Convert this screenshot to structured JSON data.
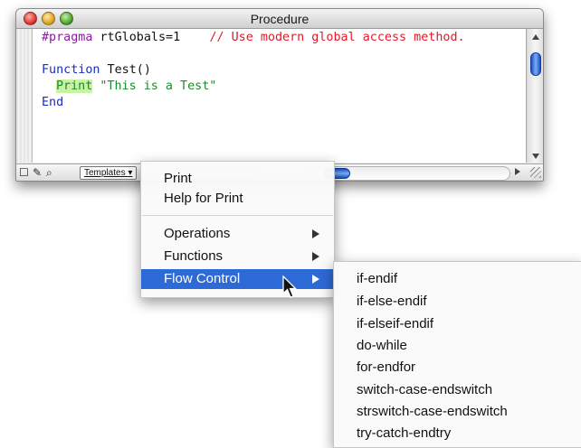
{
  "window": {
    "title": "Procedure"
  },
  "editor": {
    "line1": {
      "pragma": "#pragma",
      "text": " rtGlobals=1",
      "comment": "// Use modern global access method."
    },
    "line2": {
      "keyword": "Function",
      "text": " Test()"
    },
    "line3": {
      "keyword": "Print",
      "string": "\"This is a Test\""
    },
    "line4": {
      "keyword": "End"
    }
  },
  "toolbar": {
    "templates_label": "Templates"
  },
  "context_menu": {
    "items": [
      "Print",
      "Help for Print",
      "Operations",
      "Functions",
      "Flow Control"
    ],
    "selected": "Flow Control"
  },
  "submenu": {
    "items": [
      "if-endif",
      "if-else-endif",
      "if-elseif-endif",
      "do-while",
      "for-endfor",
      "switch-case-endswitch",
      "strswitch-case-endswitch",
      "try-catch-endtry"
    ]
  },
  "colors": {
    "menu_highlight": "#2e6ad6",
    "pragma": "#8b1aa0",
    "comment": "#e0192a",
    "keyword": "#1a2fb8",
    "print_keyword": "#1c8a2a",
    "print_highlight": "#c9f2a2"
  }
}
